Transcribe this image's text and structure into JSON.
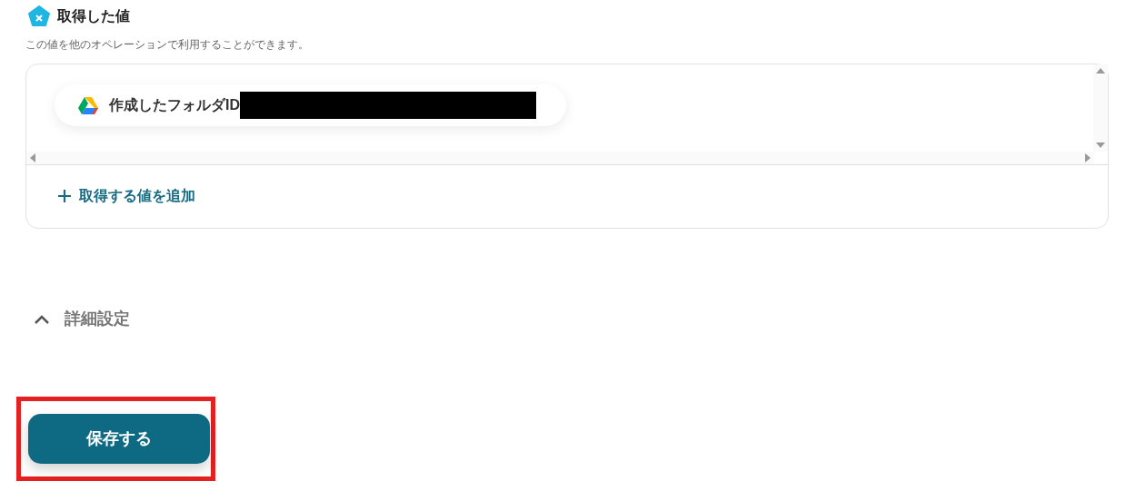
{
  "section": {
    "title": "取得した値",
    "description": "この値を他のオペレーションで利用することができます。"
  },
  "values": [
    {
      "label": "作成したフォルダID",
      "redacted": true
    }
  ],
  "add_link": {
    "label": "取得する値を追加"
  },
  "advanced": {
    "label": "詳細設定",
    "expanded": true
  },
  "save_button": {
    "label": "保存する",
    "highlighted": true
  }
}
